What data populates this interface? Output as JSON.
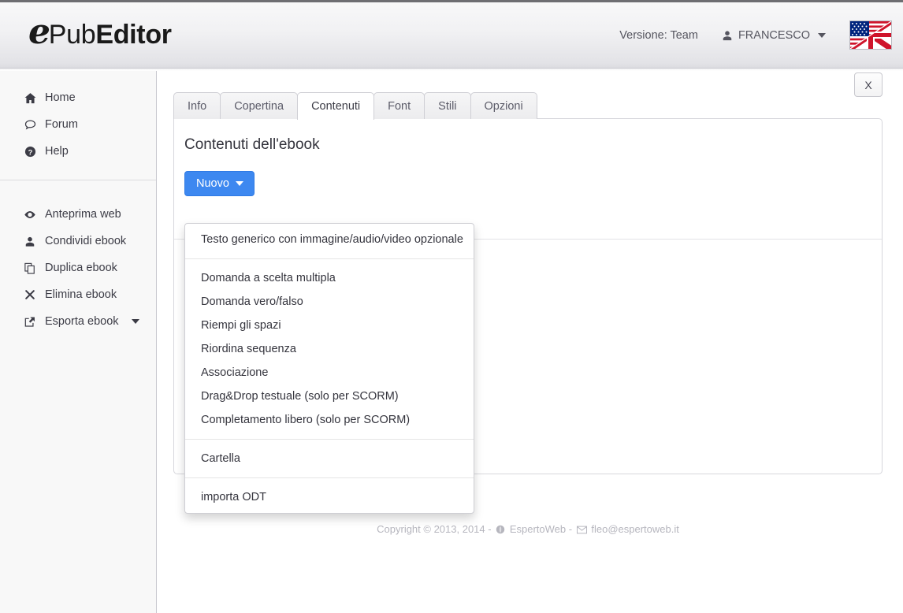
{
  "header": {
    "logo": {
      "initial": "e",
      "part1": "Pub",
      "part2": "Editor"
    },
    "version_label": "Versione: Team",
    "user_name": "FRANCESCO",
    "user_icon": "user-icon",
    "caret_icon": "chevron-down-icon",
    "language_flag": "us-uk-flag-icon"
  },
  "sidebar": {
    "group1": [
      {
        "label": "Home",
        "icon": "home-icon"
      },
      {
        "label": "Forum",
        "icon": "comment-icon"
      },
      {
        "label": "Help",
        "icon": "question-circle-icon"
      }
    ],
    "group2": [
      {
        "label": "Anteprima web",
        "icon": "eye-icon",
        "caret": false
      },
      {
        "label": "Condividi ebook",
        "icon": "user-icon",
        "caret": false
      },
      {
        "label": "Duplica ebook",
        "icon": "copy-icon",
        "caret": false
      },
      {
        "label": "Elimina ebook",
        "icon": "close-x-icon",
        "caret": false
      },
      {
        "label": "Esporta ebook",
        "icon": "external-link-icon",
        "caret": true
      }
    ]
  },
  "tabs": [
    {
      "label": "Info",
      "active": false
    },
    {
      "label": "Copertina",
      "active": false
    },
    {
      "label": "Contenuti",
      "active": true
    },
    {
      "label": "Font",
      "active": false
    },
    {
      "label": "Stili",
      "active": false
    },
    {
      "label": "Opzioni",
      "active": false
    }
  ],
  "panel": {
    "title": "Contenuti dell'ebook",
    "new_button_label": "Nuovo",
    "close_button_label": "X"
  },
  "dropdown": {
    "items": [
      {
        "label": "Testo generico con immagine/audio/video opzionale",
        "separator_after": true
      },
      {
        "label": "Domanda a scelta multipla",
        "separator_after": false
      },
      {
        "label": "Domanda vero/falso",
        "separator_after": false
      },
      {
        "label": "Riempi gli spazi",
        "separator_after": false
      },
      {
        "label": "Riordina sequenza",
        "separator_after": false
      },
      {
        "label": "Associazione",
        "separator_after": false
      },
      {
        "label": "Drag&Drop testuale (solo per SCORM)",
        "separator_after": false
      },
      {
        "label": "Completamento libero (solo per SCORM)",
        "separator_after": true
      },
      {
        "label": "Cartella",
        "separator_after": true
      },
      {
        "label": "importa ODT",
        "separator_after": false
      }
    ]
  },
  "footer": {
    "copyright": "Copyright © 2013, 2014 -",
    "site_name": "EspertoWeb",
    "separator": "-",
    "email": "fleo@espertoweb.it",
    "globe_icon": "globe-icon",
    "mail_icon": "envelope-icon"
  },
  "colors": {
    "accent_blue": "#3d88f0",
    "header_gradient_top": "#f8f8f9",
    "header_gradient_bottom": "#dcdce1",
    "sidebar_bg": "#f8f8f8",
    "text": "#34343d",
    "muted": "#b6b6be"
  }
}
